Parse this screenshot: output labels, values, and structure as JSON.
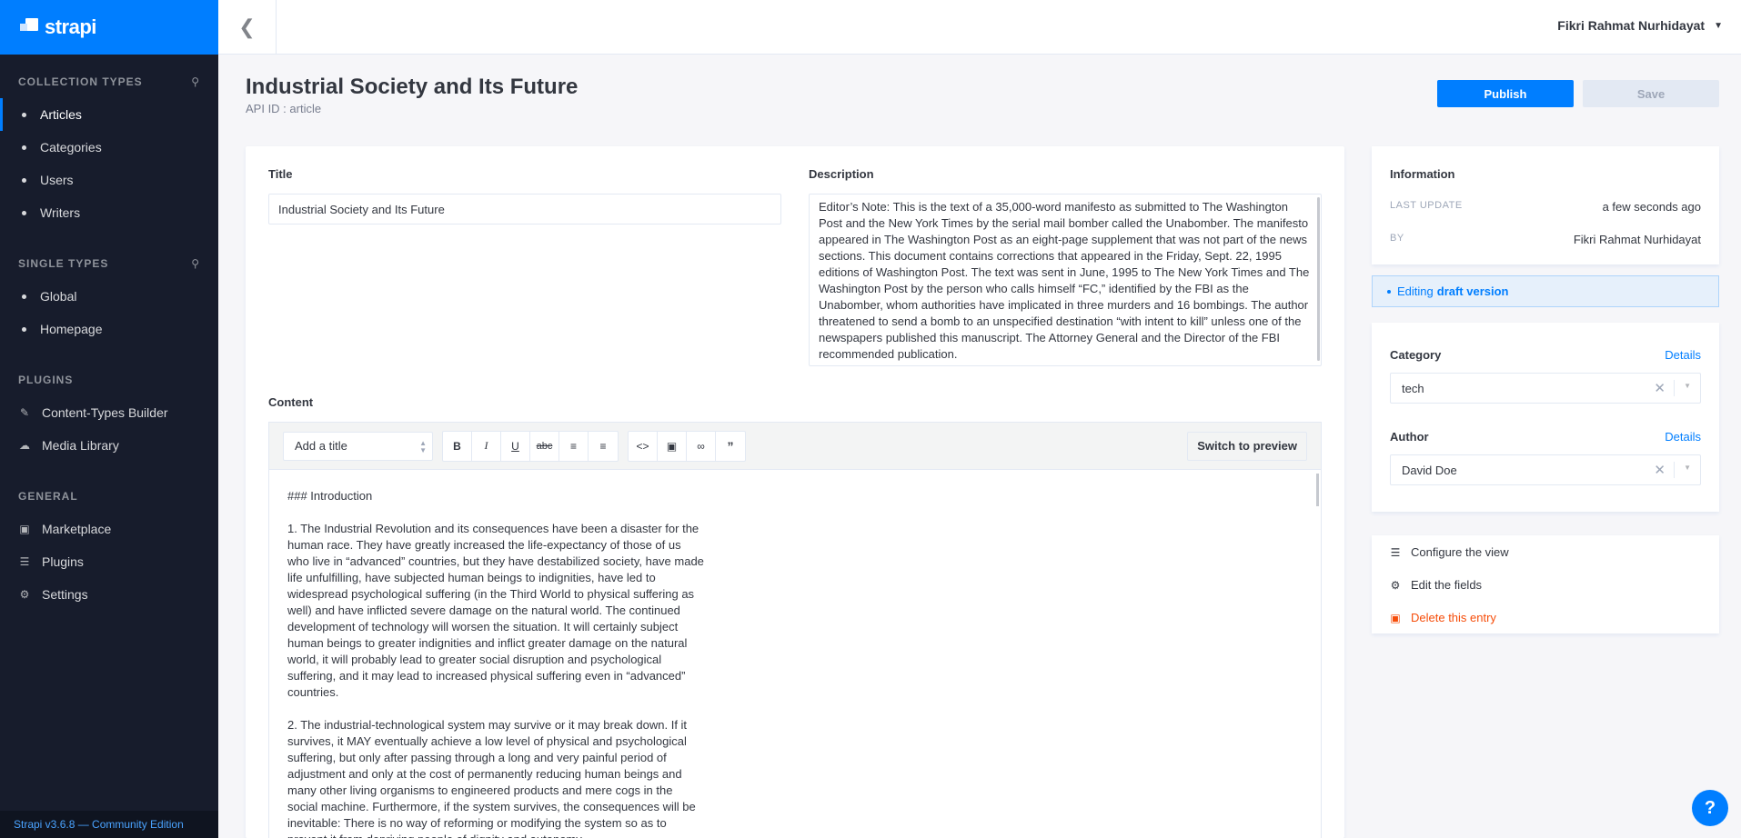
{
  "sidebar": {
    "brand": "strapi",
    "collection_types_label": "COLLECTION TYPES",
    "collection_types": [
      "Articles",
      "Categories",
      "Users",
      "Writers"
    ],
    "single_types_label": "SINGLE TYPES",
    "single_types": [
      "Global",
      "Homepage"
    ],
    "plugins_label": "PLUGINS",
    "plugins": [
      "Content-Types Builder",
      "Media Library"
    ],
    "general_label": "GENERAL",
    "general": [
      "Marketplace",
      "Plugins",
      "Settings"
    ],
    "footer": "Strapi v3.6.8 — Community Edition"
  },
  "header": {
    "user": "Fikri Rahmat Nurhidayat"
  },
  "page": {
    "title": "Industrial Society and Its Future",
    "api_id": "API ID : article",
    "publish_label": "Publish",
    "save_label": "Save"
  },
  "form": {
    "title_label": "Title",
    "title_value": "Industrial Society and Its Future",
    "description_label": "Description",
    "description_value": " Editor’s Note: This is the text of a 35,000-word manifesto as submitted to The Washington Post and the New York Times by the serial mail bomber called the Unabomber. The manifesto appeared in The Washington Post as an eight-page supplement that was not part of the news sections. This document contains corrections that appeared in the Friday, Sept. 22, 1995 editions of Washington Post. The text was sent in June, 1995 to The New York Times and The Washington Post by the person who calls himself “FC,” identified by the FBI as the Unabomber, whom authorities have implicated in three murders and 16 bombings. The author threatened to send a bomb to an unspecified destination “with intent to kill” unless one of the newspapers published this manuscript. The Attorney General and the Director of the FBI recommended publication.",
    "content_label": "Content",
    "editor": {
      "heading_select": "Add a title",
      "switch_label": "Switch to preview",
      "content": "### Introduction\n\n1. The Industrial Revolution and its consequences have been a disaster for the human race. They have greatly increased the life-expectancy of those of us who live in “advanced” countries, but they have destabilized society, have made life unfulfilling, have subjected human beings to indignities, have led to widespread psychological suffering (in the Third World to physical suffering as well) and have inflicted severe damage on the natural world. The continued development of technology will worsen the situation. It will certainly subject human beings to greater indignities and inflict greater damage on the natural world, it will probably lead to greater social disruption and psychological suffering, and it may lead to increased physical suffering even in “advanced” countries.\n\n2. The industrial-technological system may survive or it may break down. If it survives, it MAY eventually achieve a low level of physical and psychological suffering, but only after passing through a long and very painful period of adjustment and only at the cost of permanently reducing human beings and many other living organisms to engineered products and mere cogs in the social machine. Furthermore, if the system survives, the consequences will be inevitable: There is no way of reforming or modifying the system so as to prevent it from depriving people of dignity and autonomy."
    }
  },
  "info": {
    "title": "Information",
    "last_update_label": "LAST UPDATE",
    "last_update_value": "a few seconds ago",
    "by_label": "BY",
    "by_value": "Fikri Rahmat Nurhidayat",
    "draft_prefix": "Editing",
    "draft_bold": "draft version"
  },
  "relations": {
    "category_label": "Category",
    "category_value": "tech",
    "author_label": "Author",
    "author_value": "David Doe",
    "details_label": "Details"
  },
  "actions": {
    "configure": "Configure the view",
    "edit_fields": "Edit the fields",
    "delete": "Delete this entry"
  },
  "help": "?"
}
